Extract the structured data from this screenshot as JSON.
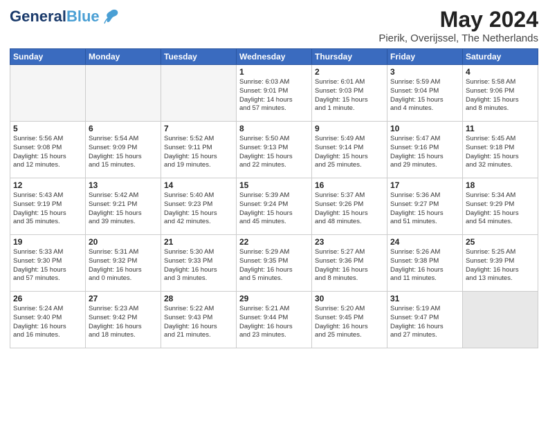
{
  "header": {
    "logo_line1": "General",
    "logo_line2": "Blue",
    "month_year": "May 2024",
    "location": "Pierik, Overijssel, The Netherlands"
  },
  "days_of_week": [
    "Sunday",
    "Monday",
    "Tuesday",
    "Wednesday",
    "Thursday",
    "Friday",
    "Saturday"
  ],
  "weeks": [
    [
      {
        "num": "",
        "info": "",
        "empty": true
      },
      {
        "num": "",
        "info": "",
        "empty": true
      },
      {
        "num": "",
        "info": "",
        "empty": true
      },
      {
        "num": "1",
        "info": "Sunrise: 6:03 AM\nSunset: 9:01 PM\nDaylight: 14 hours\nand 57 minutes."
      },
      {
        "num": "2",
        "info": "Sunrise: 6:01 AM\nSunset: 9:03 PM\nDaylight: 15 hours\nand 1 minute."
      },
      {
        "num": "3",
        "info": "Sunrise: 5:59 AM\nSunset: 9:04 PM\nDaylight: 15 hours\nand 4 minutes."
      },
      {
        "num": "4",
        "info": "Sunrise: 5:58 AM\nSunset: 9:06 PM\nDaylight: 15 hours\nand 8 minutes."
      }
    ],
    [
      {
        "num": "5",
        "info": "Sunrise: 5:56 AM\nSunset: 9:08 PM\nDaylight: 15 hours\nand 12 minutes."
      },
      {
        "num": "6",
        "info": "Sunrise: 5:54 AM\nSunset: 9:09 PM\nDaylight: 15 hours\nand 15 minutes."
      },
      {
        "num": "7",
        "info": "Sunrise: 5:52 AM\nSunset: 9:11 PM\nDaylight: 15 hours\nand 19 minutes."
      },
      {
        "num": "8",
        "info": "Sunrise: 5:50 AM\nSunset: 9:13 PM\nDaylight: 15 hours\nand 22 minutes."
      },
      {
        "num": "9",
        "info": "Sunrise: 5:49 AM\nSunset: 9:14 PM\nDaylight: 15 hours\nand 25 minutes."
      },
      {
        "num": "10",
        "info": "Sunrise: 5:47 AM\nSunset: 9:16 PM\nDaylight: 15 hours\nand 29 minutes."
      },
      {
        "num": "11",
        "info": "Sunrise: 5:45 AM\nSunset: 9:18 PM\nDaylight: 15 hours\nand 32 minutes."
      }
    ],
    [
      {
        "num": "12",
        "info": "Sunrise: 5:43 AM\nSunset: 9:19 PM\nDaylight: 15 hours\nand 35 minutes."
      },
      {
        "num": "13",
        "info": "Sunrise: 5:42 AM\nSunset: 9:21 PM\nDaylight: 15 hours\nand 39 minutes."
      },
      {
        "num": "14",
        "info": "Sunrise: 5:40 AM\nSunset: 9:23 PM\nDaylight: 15 hours\nand 42 minutes."
      },
      {
        "num": "15",
        "info": "Sunrise: 5:39 AM\nSunset: 9:24 PM\nDaylight: 15 hours\nand 45 minutes."
      },
      {
        "num": "16",
        "info": "Sunrise: 5:37 AM\nSunset: 9:26 PM\nDaylight: 15 hours\nand 48 minutes."
      },
      {
        "num": "17",
        "info": "Sunrise: 5:36 AM\nSunset: 9:27 PM\nDaylight: 15 hours\nand 51 minutes."
      },
      {
        "num": "18",
        "info": "Sunrise: 5:34 AM\nSunset: 9:29 PM\nDaylight: 15 hours\nand 54 minutes."
      }
    ],
    [
      {
        "num": "19",
        "info": "Sunrise: 5:33 AM\nSunset: 9:30 PM\nDaylight: 15 hours\nand 57 minutes."
      },
      {
        "num": "20",
        "info": "Sunrise: 5:31 AM\nSunset: 9:32 PM\nDaylight: 16 hours\nand 0 minutes."
      },
      {
        "num": "21",
        "info": "Sunrise: 5:30 AM\nSunset: 9:33 PM\nDaylight: 16 hours\nand 3 minutes."
      },
      {
        "num": "22",
        "info": "Sunrise: 5:29 AM\nSunset: 9:35 PM\nDaylight: 16 hours\nand 5 minutes."
      },
      {
        "num": "23",
        "info": "Sunrise: 5:27 AM\nSunset: 9:36 PM\nDaylight: 16 hours\nand 8 minutes."
      },
      {
        "num": "24",
        "info": "Sunrise: 5:26 AM\nSunset: 9:38 PM\nDaylight: 16 hours\nand 11 minutes."
      },
      {
        "num": "25",
        "info": "Sunrise: 5:25 AM\nSunset: 9:39 PM\nDaylight: 16 hours\nand 13 minutes."
      }
    ],
    [
      {
        "num": "26",
        "info": "Sunrise: 5:24 AM\nSunset: 9:40 PM\nDaylight: 16 hours\nand 16 minutes."
      },
      {
        "num": "27",
        "info": "Sunrise: 5:23 AM\nSunset: 9:42 PM\nDaylight: 16 hours\nand 18 minutes."
      },
      {
        "num": "28",
        "info": "Sunrise: 5:22 AM\nSunset: 9:43 PM\nDaylight: 16 hours\nand 21 minutes."
      },
      {
        "num": "29",
        "info": "Sunrise: 5:21 AM\nSunset: 9:44 PM\nDaylight: 16 hours\nand 23 minutes."
      },
      {
        "num": "30",
        "info": "Sunrise: 5:20 AM\nSunset: 9:45 PM\nDaylight: 16 hours\nand 25 minutes."
      },
      {
        "num": "31",
        "info": "Sunrise: 5:19 AM\nSunset: 9:47 PM\nDaylight: 16 hours\nand 27 minutes."
      },
      {
        "num": "",
        "info": "",
        "empty": true,
        "shaded": true
      }
    ]
  ]
}
